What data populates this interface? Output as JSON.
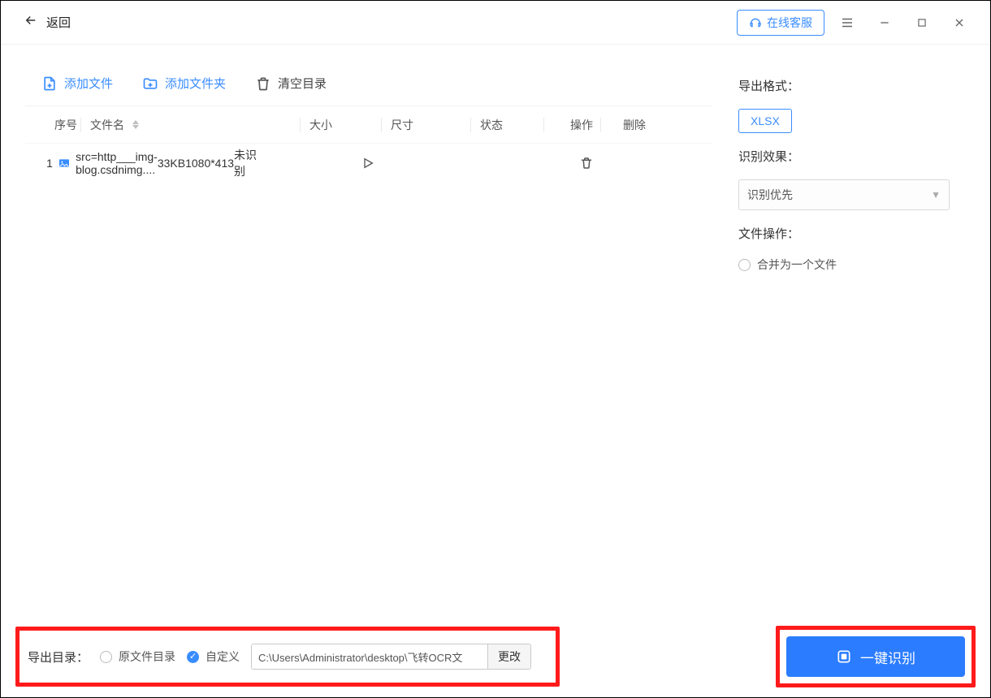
{
  "titlebar": {
    "back": "返回",
    "support": "在线客服"
  },
  "toolbar": {
    "add_file": "添加文件",
    "add_folder": "添加文件夹",
    "clear": "清空目录"
  },
  "table": {
    "headers": {
      "index": "序号",
      "filename": "文件名",
      "size": "大小",
      "dimension": "尺寸",
      "status": "状态",
      "operation": "操作",
      "delete": "删除"
    },
    "rows": [
      {
        "index": "1",
        "filename": "src=http___img-blog.csdnimg....",
        "size": "33KB",
        "dimension": "1080*413",
        "status": "未识别"
      }
    ]
  },
  "right": {
    "format_label": "导出格式：",
    "format_value": "XLSX",
    "effect_label": "识别效果：",
    "effect_value": "识别优先",
    "fileop_label": "文件操作：",
    "merge_option": "合并为一个文件"
  },
  "footer": {
    "export_label": "导出目录：",
    "opt_original": "原文件目录",
    "opt_custom": "自定义",
    "path_value": "C:\\Users\\Administrator\\desktop\\飞转OCR文",
    "change": "更改",
    "recognize": "一键识别"
  }
}
